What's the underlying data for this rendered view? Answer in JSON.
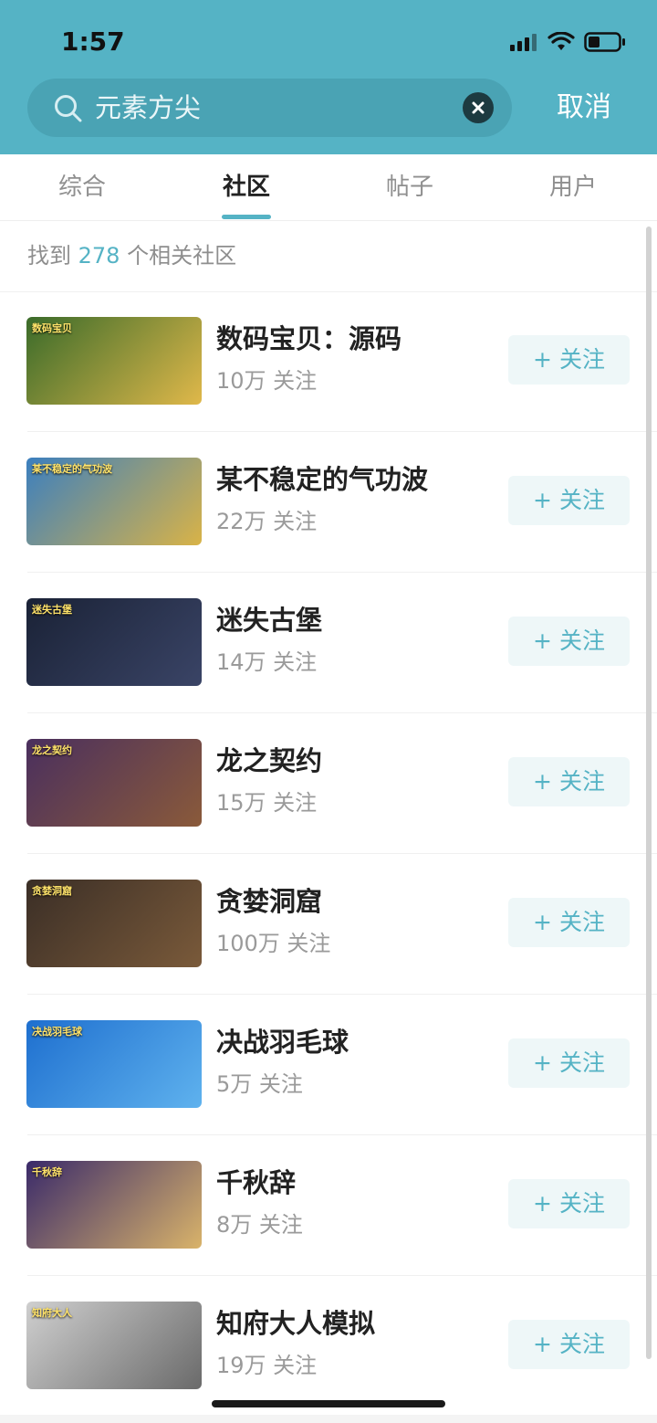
{
  "status_bar": {
    "time": "1:57"
  },
  "search": {
    "query": "元素方尖",
    "cancel_label": "取消"
  },
  "tabs": [
    {
      "label": "综合"
    },
    {
      "label": "社区",
      "active": true
    },
    {
      "label": "帖子"
    },
    {
      "label": "用户"
    }
  ],
  "results": {
    "prefix": "找到",
    "count": "278",
    "suffix": "个相关社区"
  },
  "follow_label": "+ 关注",
  "communities": [
    {
      "name": "数码宝贝：源码",
      "followers": "10万 关注",
      "thumb_label": "数码宝贝",
      "colors": [
        "#3a6b2a",
        "#e0b84a"
      ]
    },
    {
      "name": "某不稳定的气功波",
      "followers": "22万 关注",
      "thumb_label": "某不稳定的气功波",
      "colors": [
        "#3b7fbf",
        "#d9b347"
      ]
    },
    {
      "name": "迷失古堡",
      "followers": "14万 关注",
      "thumb_label": "迷失古堡",
      "colors": [
        "#1a2236",
        "#3a4466"
      ]
    },
    {
      "name": "龙之契约",
      "followers": "15万 关注",
      "thumb_label": "龙之契约",
      "colors": [
        "#4a2f5e",
        "#8a5a3a"
      ]
    },
    {
      "name": "贪婪洞窟",
      "followers": "100万 关注",
      "thumb_label": "贪婪洞窟",
      "colors": [
        "#3a2e26",
        "#7a5a3a"
      ]
    },
    {
      "name": "决战羽毛球",
      "followers": "5万 关注",
      "thumb_label": "决战羽毛球",
      "colors": [
        "#1e6fcf",
        "#5fb2ee"
      ]
    },
    {
      "name": "千秋辞",
      "followers": "8万 关注",
      "thumb_label": "千秋辞",
      "colors": [
        "#3a2a6a",
        "#d9b36a"
      ]
    },
    {
      "name": "知府大人模拟",
      "followers": "19万 关注",
      "thumb_label": "知府大人",
      "colors": [
        "#cfcfcf",
        "#6a6a6a"
      ]
    }
  ]
}
